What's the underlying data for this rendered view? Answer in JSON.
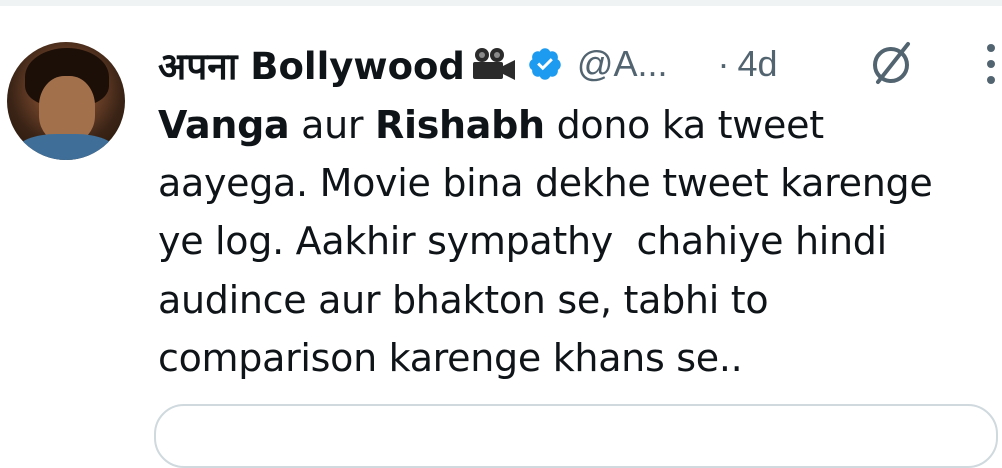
{
  "tweet": {
    "display_name": "अपना Bollywood",
    "camera_icon": "movie-camera-icon",
    "verified_icon": "verified-badge-icon",
    "verified_color": "#1d9bf0",
    "handle": "@A...",
    "separator": "·",
    "time": "4d",
    "grok_icon": "grok-icon",
    "more_icon": "more-options-icon",
    "text_lines": [
      {
        "bold_1": "Vanga",
        "plain_1": " aur ",
        "bold_2": "Rishabh",
        "plain_2": " dono ka tweet"
      },
      {
        "plain": "aayega. Movie bina dekhe tweet karenge"
      },
      {
        "plain": "ye log. Aakhir sympathy  chahiye hindi"
      },
      {
        "plain": "audince aur bhakton se, tabhi to"
      },
      {
        "plain": "comparison karenge khans se.."
      }
    ]
  },
  "colors": {
    "text_primary": "#0f1419",
    "text_secondary": "#536471",
    "border": "#cfd9de",
    "accent": "#1d9bf0"
  }
}
